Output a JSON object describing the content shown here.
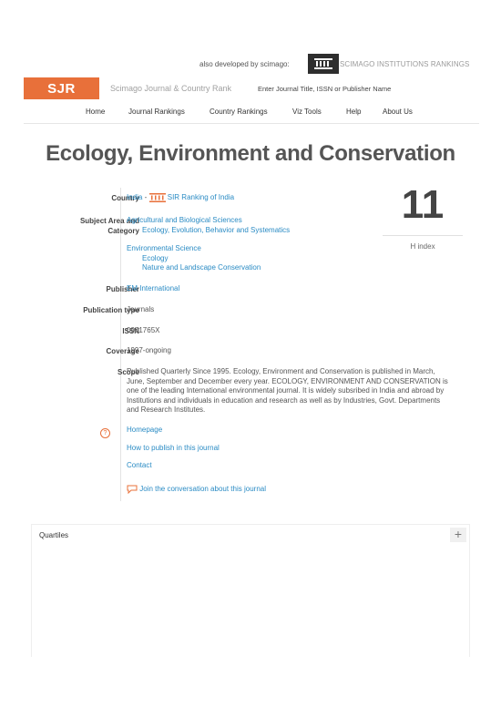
{
  "topbar": {
    "also_developed": "also developed by scimago:",
    "institutions": "SCIMAGO INSTITUTIONS RANKINGS"
  },
  "header": {
    "logo": "SJR",
    "subtitle": "Scimago Journal & Country Rank",
    "search_placeholder": "Enter Journal Title, ISSN or Publisher Name"
  },
  "nav": {
    "items": [
      "Home",
      "Journal Rankings",
      "Country Rankings",
      "Viz Tools",
      "Help",
      "About Us"
    ]
  },
  "journal": {
    "title": "Ecology, Environment and Conservation",
    "country_label": "Country",
    "country": "India",
    "country_sep": "-",
    "sir_ranking": "SIR Ranking of India",
    "subject_label": "Subject Area and Category",
    "subject_label_1": "Subject Area and",
    "subject_label_2": "Category",
    "subjects": [
      {
        "area": "Agricultural and Biological Sciences",
        "categories": [
          "Ecology, Evolution, Behavior and Systematics"
        ]
      },
      {
        "area": "Environmental Science",
        "categories": [
          "Ecology",
          "Nature and Landscape Conservation"
        ]
      }
    ],
    "publisher_label": "Publisher",
    "publisher": "EM International",
    "pubtype_label": "Publication type",
    "pubtype": "Journals",
    "issn_label": "ISSN",
    "issn": "0971765X",
    "coverage_label": "Coverage",
    "coverage": "1997-ongoing",
    "scope_label": "Scope",
    "scope": "Published Quarterly Since 1995. Ecology, Environment and Conservation is published in March, June, September and December every year. ECOLOGY, ENVIRONMENT AND CONSERVATION is one of the leading International environmental journal. It is widely subsribed in India and abroad by Institutions and individuals in education and research as well as by Industries, Govt. Departments and Research Institutes.",
    "links": {
      "homepage": "Homepage",
      "how_to_publish": "How to publish in this journal",
      "contact": "Contact",
      "conversation": "Join the conversation about this journal"
    },
    "h_index": "11",
    "h_index_label": "H index"
  },
  "quartiles": {
    "title": "Quartiles",
    "expand": "+"
  },
  "colors": {
    "accent": "#e8703a",
    "link": "#2a8bc4"
  }
}
